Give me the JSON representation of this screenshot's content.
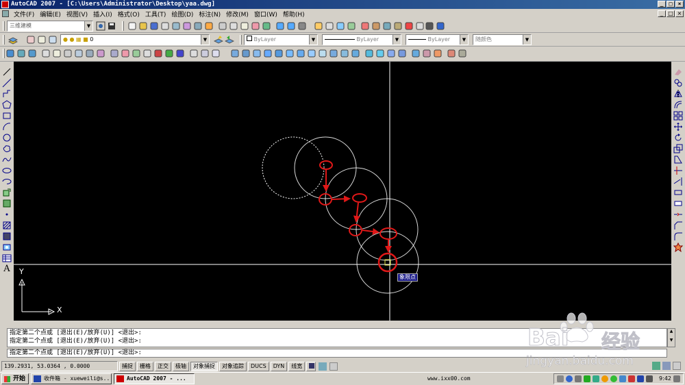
{
  "window": {
    "title": "AutoCAD 2007 - [C:\\Users\\Administrator\\Desktop\\yaa.dwg]",
    "buttons": [
      "_",
      "□",
      "×"
    ]
  },
  "menu": {
    "items": [
      "文件(F)",
      "编辑(E)",
      "视图(V)",
      "插入(I)",
      "格式(O)",
      "工具(T)",
      "绘图(D)",
      "标注(N)",
      "修改(M)",
      "窗口(W)",
      "帮助(H)"
    ],
    "doc_buttons": [
      "_",
      "□",
      "×"
    ]
  },
  "toolbar1": {
    "workspace": "三维建模"
  },
  "toolbar2": {
    "layer": "0",
    "color": "ByLayer",
    "linetype": "ByLayer",
    "lineweight": "ByLayer",
    "plotstyle": "随颜色"
  },
  "canvas": {
    "tooltip": "象限点",
    "ucs_x": "X",
    "ucs_y": "Y",
    "colors": {
      "background": "#000000",
      "geometry": "#ffffff",
      "annotation": "#e01818",
      "tooltip_bg": "#1c1c8a"
    }
  },
  "command": {
    "history": [
      "指定第二个点或 [退出(E)/放弃(U)] <退出>:",
      "指定第二个点或 [退出(E)/放弃(U)] <退出>:"
    ],
    "current": "指定第二个点或 [退出(E)/放弃(U)] <退出>:"
  },
  "status": {
    "coords": "139.2931, 53.0364 , 0.0000",
    "toggles": [
      "捕捉",
      "栅格",
      "正交",
      "极轴",
      "对象捕捉",
      "对象追踪",
      "DUCS",
      "DYN",
      "线宽"
    ]
  },
  "taskbar": {
    "start": "开始",
    "tasks": [
      "收件箱 - xueweili@s...",
      "AutoCAD 2007 - ..."
    ],
    "url": "www.ixx00.com",
    "clock": "9:42"
  },
  "watermark": {
    "text1": "Bai",
    "text2": "经验",
    "url": "jingyan.baidu.com"
  }
}
